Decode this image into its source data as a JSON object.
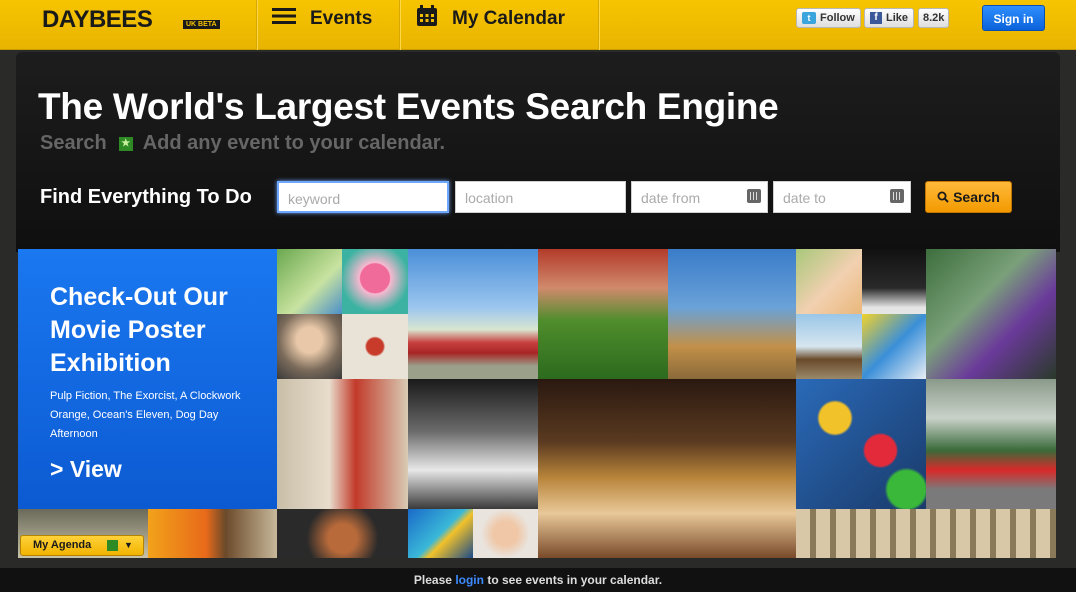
{
  "header": {
    "logo": "DAYBEES",
    "logo_badge": "UK BETA",
    "nav": [
      {
        "label": "Events",
        "icon": "menu-icon"
      },
      {
        "label": "My Calendar",
        "icon": "calendar-icon"
      }
    ],
    "twitter": {
      "label": "Follow"
    },
    "facebook": {
      "label": "Like",
      "count": "8.2k"
    },
    "signin": "Sign in"
  },
  "hero": {
    "headline": "The World's Largest Events Search Engine",
    "sub_search": "Search",
    "sub_rest": "Add any event to your calendar.",
    "find_label": "Find Everything To Do",
    "fields": {
      "keyword_placeholder": "keyword",
      "location_placeholder": "location",
      "date_from_placeholder": "date from",
      "date_to_placeholder": "date to"
    },
    "search_button": "Search"
  },
  "promo": {
    "title": "Check-Out Our Movie Poster Exhibition",
    "description": "Pulp Fiction, The Exorcist, A Clockwork Orange, Ocean's Eleven, Dog Day Afternoon",
    "link": "> View"
  },
  "agenda": {
    "label": "My Agenda"
  },
  "footer": {
    "before": "Please",
    "link": "login",
    "after": "to see events in your calendar."
  },
  "colors": {
    "brand": "#f7c400",
    "accent": "#1a78f0",
    "search": "#f5a412"
  }
}
